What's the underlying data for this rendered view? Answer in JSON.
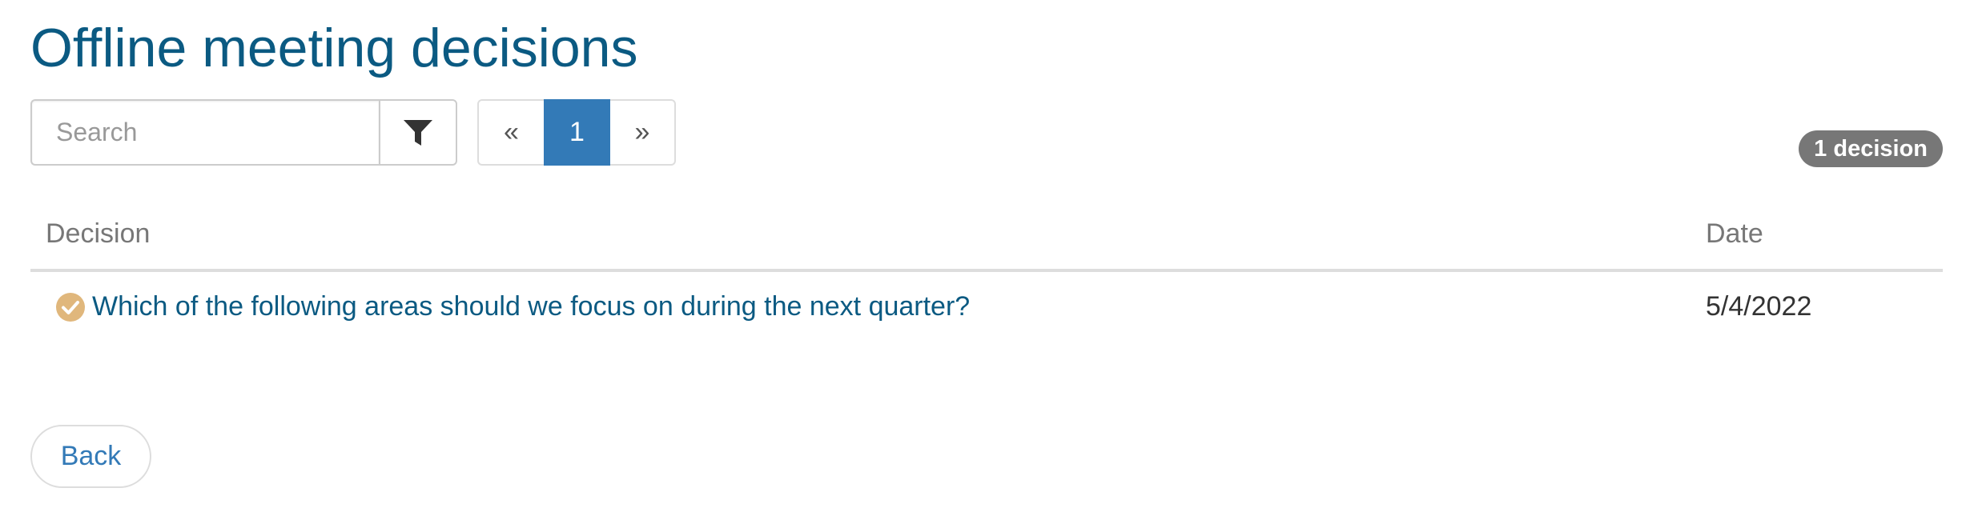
{
  "page": {
    "title": "Offline meeting decisions"
  },
  "search": {
    "placeholder": "Search",
    "value": ""
  },
  "filter": {
    "icon": "filter-icon"
  },
  "pagination": {
    "prev_label": "«",
    "current_label": "1",
    "next_label": "»"
  },
  "badge": {
    "count_label": "1 decision"
  },
  "table": {
    "headers": {
      "decision": "Decision",
      "date": "Date"
    },
    "rows": [
      {
        "status_icon": "check-circle-icon",
        "decision": "Which of the following areas should we focus on during the next quarter?",
        "date": "5/4/2022"
      }
    ]
  },
  "footer": {
    "back_label": "Back"
  },
  "colors": {
    "title": "#0b5a82",
    "link": "#0b5a82",
    "accent": "#337ab7",
    "badge": "#777777",
    "status_icon": "#e0b77c"
  }
}
